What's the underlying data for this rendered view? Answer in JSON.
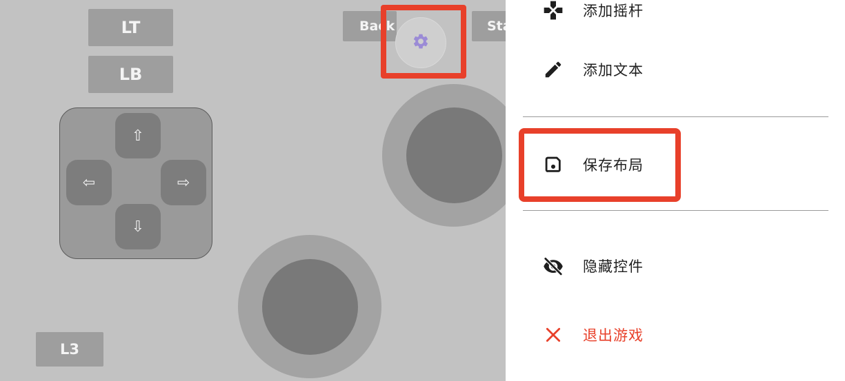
{
  "gamepad": {
    "lt_label": "LT",
    "lb_label": "LB",
    "l3_label": "L3",
    "back_label": "Back",
    "start_label": "Start",
    "dpad": {
      "up": "⇧",
      "down": "⇩",
      "left": "⇦",
      "right": "⇨"
    },
    "settings_icon": "gear-icon",
    "accent_color": "#9b8bd6"
  },
  "menu": {
    "items": [
      {
        "icon": "gamepad-icon",
        "label": "添加摇杆"
      },
      {
        "icon": "pencil-icon",
        "label": "添加文本"
      },
      {
        "icon": "save-icon",
        "label": "保存布局"
      },
      {
        "icon": "eye-off-icon",
        "label": "隐藏控件"
      },
      {
        "icon": "close-icon",
        "label": "退出游戏",
        "color": "#e8402a"
      }
    ]
  },
  "highlight_color": "#e8402a"
}
